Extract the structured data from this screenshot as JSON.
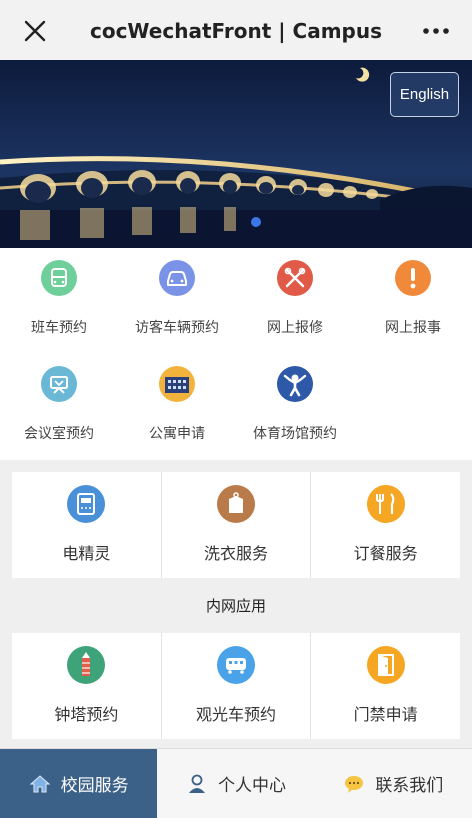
{
  "titlebar": {
    "title": "cocWechatFront | Campus",
    "close_icon": "close-icon",
    "more_icon": "more-icon"
  },
  "banner": {
    "language_button": "English",
    "carousel_active_index": 0
  },
  "services": [
    {
      "label": "班车预约",
      "icon": "bus-icon",
      "color": "#6fcf9a"
    },
    {
      "label": "访客车辆预约",
      "icon": "car-icon",
      "color": "#7b93e6"
    },
    {
      "label": "网上报修",
      "icon": "tools-icon",
      "color": "#e05a47"
    },
    {
      "label": "网上报事",
      "icon": "alert-icon",
      "color": "#f08a3a"
    },
    {
      "label": "会议室预约",
      "icon": "meeting-icon",
      "color": "#6ab7d6"
    },
    {
      "label": "公寓申请",
      "icon": "apartment-icon",
      "color": "#f2b33d"
    },
    {
      "label": "体育场馆预约",
      "icon": "gym-icon",
      "color": "#2e59a8"
    }
  ],
  "life_cards": [
    {
      "label": "电精灵",
      "icon": "meter-icon",
      "color": "#4a90d9"
    },
    {
      "label": "洗衣服务",
      "icon": "laundry-icon",
      "color": "#b97b4a"
    },
    {
      "label": "订餐服务",
      "icon": "dining-icon",
      "color": "#f5a623"
    }
  ],
  "intranet": {
    "title": "内网应用",
    "cards": [
      {
        "label": "钟塔预约",
        "icon": "tower-icon",
        "color": "#3fa37a"
      },
      {
        "label": "观光车预约",
        "icon": "sightseeing-bus-icon",
        "color": "#4aa3e8"
      },
      {
        "label": "门禁申请",
        "icon": "door-icon",
        "color": "#f5a623"
      }
    ]
  },
  "tabbar": {
    "tabs": [
      {
        "label": "校园服务",
        "icon": "home-icon",
        "active": true
      },
      {
        "label": "个人中心",
        "icon": "user-icon",
        "active": false
      },
      {
        "label": "联系我们",
        "icon": "chat-icon",
        "active": false
      }
    ]
  }
}
